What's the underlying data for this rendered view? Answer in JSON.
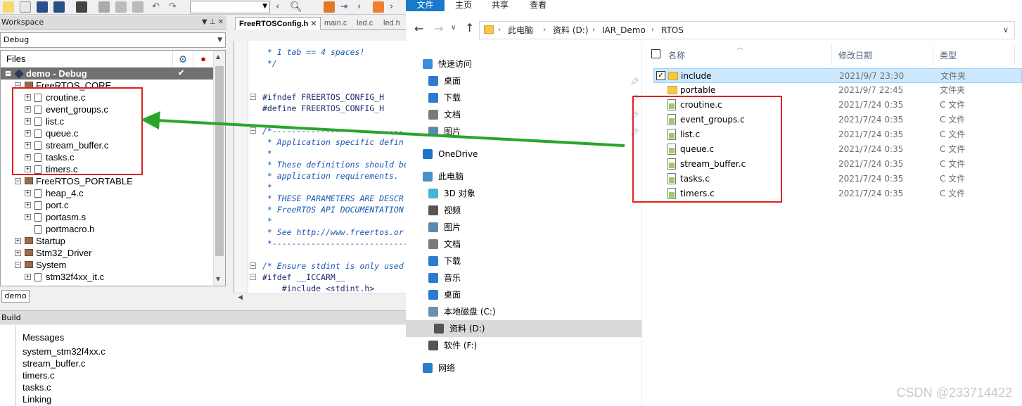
{
  "iar": {
    "workspace_title": "Workspace",
    "config": "Debug",
    "files_header": "Files",
    "tree": [
      {
        "label": "demo - Debug",
        "kind": "project",
        "level": 0,
        "selected": true,
        "check": "✔"
      },
      {
        "label": "FreeRTOS_CORE",
        "kind": "folder",
        "level": 1
      },
      {
        "label": "croutine.c",
        "kind": "file",
        "level": 2
      },
      {
        "label": "event_groups.c",
        "kind": "file",
        "level": 2
      },
      {
        "label": "list.c",
        "kind": "file",
        "level": 2
      },
      {
        "label": "queue.c",
        "kind": "file",
        "level": 2
      },
      {
        "label": "stream_buffer.c",
        "kind": "file",
        "level": 2
      },
      {
        "label": "tasks.c",
        "kind": "file",
        "level": 2
      },
      {
        "label": "timers.c",
        "kind": "file",
        "level": 2
      },
      {
        "label": "FreeRTOS_PORTABLE",
        "kind": "folder",
        "level": 1
      },
      {
        "label": "heap_4.c",
        "kind": "file",
        "level": 2
      },
      {
        "label": "port.c",
        "kind": "file",
        "level": 2
      },
      {
        "label": "portasm.s",
        "kind": "file",
        "level": 2
      },
      {
        "label": "portmacro.h",
        "kind": "file",
        "level": 2,
        "noexp": true
      },
      {
        "label": "Startup",
        "kind": "folder",
        "level": 1
      },
      {
        "label": "Stm32_Driver",
        "kind": "folder",
        "level": 1
      },
      {
        "label": "System",
        "kind": "folder",
        "level": 1
      },
      {
        "label": "stm32f4xx_it.c",
        "kind": "file",
        "level": 2
      }
    ],
    "ws_tab": "demo",
    "editor_tabs": [
      "FreeRTOSConfig.h",
      "main.c",
      "led.c",
      "led.h"
    ],
    "code_lines": [
      {
        "t": " * 1 tab == 4 spaces!",
        "c": "cmt"
      },
      {
        "t": " */",
        "c": "cmt"
      },
      {
        "t": "",
        "c": ""
      },
      {
        "t": "",
        "c": ""
      },
      {
        "t": "#ifndef FREERTOS_CONFIG_H",
        "c": "pp"
      },
      {
        "t": "#define FREERTOS_CONFIG_H",
        "c": "pp"
      },
      {
        "t": "",
        "c": ""
      },
      {
        "t": "/*---------------------------",
        "c": "cmt"
      },
      {
        "t": " * Application specific defin",
        "c": "cmt"
      },
      {
        "t": " *",
        "c": "cmt"
      },
      {
        "t": " * These definitions should be",
        "c": "cmt"
      },
      {
        "t": " * application requirements.",
        "c": "cmt"
      },
      {
        "t": " *",
        "c": "cmt"
      },
      {
        "t": " * THESE PARAMETERS ARE DESCR",
        "c": "cmt"
      },
      {
        "t": " * FreeRTOS API DOCUMENTATION",
        "c": "cmt"
      },
      {
        "t": " *",
        "c": "cmt"
      },
      {
        "t": " * See http://www.freertos.or",
        "c": "cmt"
      },
      {
        "t": " *----------------------------",
        "c": "cmt"
      },
      {
        "t": "",
        "c": ""
      },
      {
        "t": "/* Ensure stdint is only used",
        "c": "cmt"
      },
      {
        "t": "#ifdef __ICCARM__",
        "c": "pp"
      },
      {
        "t": "    #include <stdint.h>",
        "c": "pp"
      }
    ],
    "build_title": "Build",
    "build_header": "Messages",
    "build_lines": [
      "system_stm32f4xx.c",
      "stream_buffer.c",
      "timers.c",
      "tasks.c",
      "Linking"
    ]
  },
  "explorer": {
    "ribbon": {
      "file": "文件",
      "tabs": [
        "主页",
        "共享",
        "查看"
      ]
    },
    "breadcrumb": [
      "此电脑",
      "资料 (D:)",
      "IAR_Demo",
      "RTOS"
    ],
    "nav": [
      {
        "label": "快速访问",
        "icon": "star-icon",
        "color": "#3b8ed8"
      },
      {
        "label": "桌面",
        "icon": "desktop-icon",
        "color": "#2b7bd1",
        "pin": true
      },
      {
        "label": "下载",
        "icon": "download-icon",
        "color": "#2b7bd1",
        "pin": true
      },
      {
        "label": "文档",
        "icon": "document-icon",
        "color": "#7a7a7a",
        "pin": true
      },
      {
        "label": "图片",
        "icon": "picture-icon",
        "color": "#5a8ab0",
        "pin": true
      },
      {
        "label": "OneDrive",
        "icon": "cloud-icon",
        "color": "#1e73c8"
      },
      {
        "label": "此电脑",
        "icon": "computer-icon",
        "color": "#4a90c8"
      },
      {
        "label": "3D 对象",
        "icon": "cube-icon",
        "color": "#47b5d8"
      },
      {
        "label": "视频",
        "icon": "video-icon",
        "color": "#555555"
      },
      {
        "label": "图片",
        "icon": "picture-icon",
        "color": "#5a8ab0"
      },
      {
        "label": "文档",
        "icon": "document-icon",
        "color": "#7a7a7a"
      },
      {
        "label": "下载",
        "icon": "download-icon",
        "color": "#2b7bd1"
      },
      {
        "label": "音乐",
        "icon": "music-icon",
        "color": "#2b7bd1"
      },
      {
        "label": "桌面",
        "icon": "desktop-icon",
        "color": "#2b7bd1"
      },
      {
        "label": "本地磁盘 (C:)",
        "icon": "drive-c-icon",
        "color": "#6a8fb0"
      },
      {
        "label": "资料 (D:)",
        "icon": "drive-icon",
        "color": "#555555",
        "selected": true
      },
      {
        "label": "软件 (F:)",
        "icon": "drive-icon",
        "color": "#555555"
      },
      {
        "label": "网络",
        "icon": "network-icon",
        "color": "#2b7bd1"
      }
    ],
    "columns": {
      "name": "名称",
      "date": "修改日期",
      "type": "类型"
    },
    "files": [
      {
        "name": "include",
        "date": "2021/9/7 23:30",
        "type": "文件夹",
        "kind": "folder",
        "selected": true
      },
      {
        "name": "portable",
        "date": "2021/9/7 22:45",
        "type": "文件夹",
        "kind": "folder"
      },
      {
        "name": "croutine.c",
        "date": "2021/7/24 0:35",
        "type": "C 文件",
        "kind": "c"
      },
      {
        "name": "event_groups.c",
        "date": "2021/7/24 0:35",
        "type": "C 文件",
        "kind": "c"
      },
      {
        "name": "list.c",
        "date": "2021/7/24 0:35",
        "type": "C 文件",
        "kind": "c"
      },
      {
        "name": "queue.c",
        "date": "2021/7/24 0:35",
        "type": "C 文件",
        "kind": "c"
      },
      {
        "name": "stream_buffer.c",
        "date": "2021/7/24 0:35",
        "type": "C 文件",
        "kind": "c"
      },
      {
        "name": "tasks.c",
        "date": "2021/7/24 0:35",
        "type": "C 文件",
        "kind": "c"
      },
      {
        "name": "timers.c",
        "date": "2021/7/24 0:35",
        "type": "C 文件",
        "kind": "c"
      }
    ]
  },
  "watermark": "CSDN @233714422",
  "colors": {
    "annotation_box": "#e02020",
    "annotation_arrow": "#2aa52a",
    "ribbon_file": "#1979ca"
  }
}
